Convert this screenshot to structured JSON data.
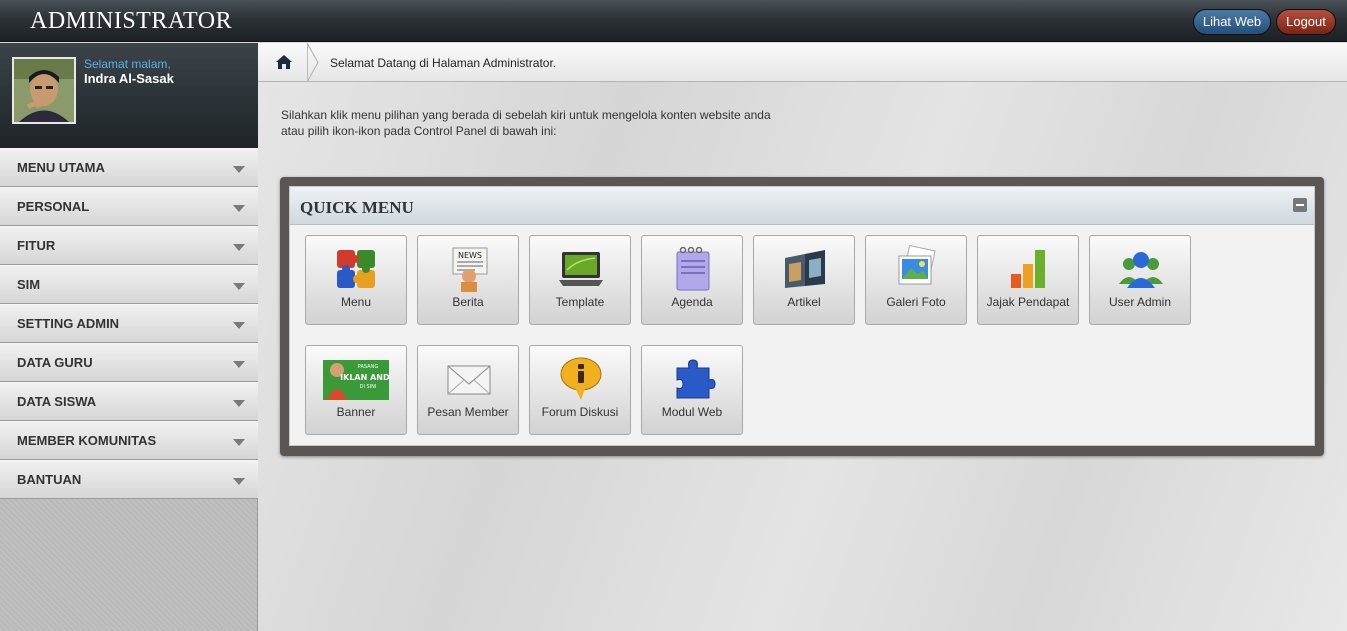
{
  "header": {
    "title": "ADMINISTRATOR",
    "view_site_label": "Lihat Web",
    "logout_label": "Logout"
  },
  "user": {
    "greeting": "Selamat malam,",
    "name": "Indra Al-Sasak"
  },
  "sidebar": {
    "items": [
      {
        "label": "MENU UTAMA"
      },
      {
        "label": "PERSONAL"
      },
      {
        "label": "FITUR"
      },
      {
        "label": "SIM"
      },
      {
        "label": "SETTING ADMIN"
      },
      {
        "label": "DATA GURU"
      },
      {
        "label": "DATA SISWA"
      },
      {
        "label": "MEMBER KOMUNITAS"
      },
      {
        "label": "BANTUAN"
      }
    ]
  },
  "breadcrumb": {
    "text": "Selamat Datang di Halaman Administrator."
  },
  "intro": {
    "line1": "Silahkan klik menu pilihan yang berada di sebelah kiri untuk mengelola konten website anda",
    "line2": "atau pilih ikon-ikon pada Control Panel di bawah ini:"
  },
  "quick_menu": {
    "title": "QUICK MENU",
    "tiles": [
      {
        "label": "Menu",
        "icon": "puzzle-icon"
      },
      {
        "label": "Berita",
        "icon": "news-icon"
      },
      {
        "label": "Template",
        "icon": "laptop-icon"
      },
      {
        "label": "Agenda",
        "icon": "notepad-icon"
      },
      {
        "label": "Artikel",
        "icon": "book-icon"
      },
      {
        "label": "Galeri Foto",
        "icon": "photos-icon"
      },
      {
        "label": "Jajak Pendapat",
        "icon": "bar-chart-icon"
      },
      {
        "label": "User Admin",
        "icon": "users-icon"
      },
      {
        "label": "Banner",
        "icon": "banner-icon"
      },
      {
        "label": "Pesan Member",
        "icon": "envelope-icon"
      },
      {
        "label": "Forum Diskusi",
        "icon": "info-bubble-icon"
      },
      {
        "label": "Modul Web",
        "icon": "puzzle-piece-icon"
      }
    ],
    "banner_art_text": [
      "PASANG",
      "IKLAN ANDA",
      "DI SINI"
    ],
    "news_art_text": "NEWS"
  },
  "colors": {
    "topbar": "#2c3236",
    "view_site_button": "#234f7a",
    "logout_button": "#7a2414",
    "greeting": "#5ab0e8",
    "quick_menu_frame": "#5a5653"
  }
}
